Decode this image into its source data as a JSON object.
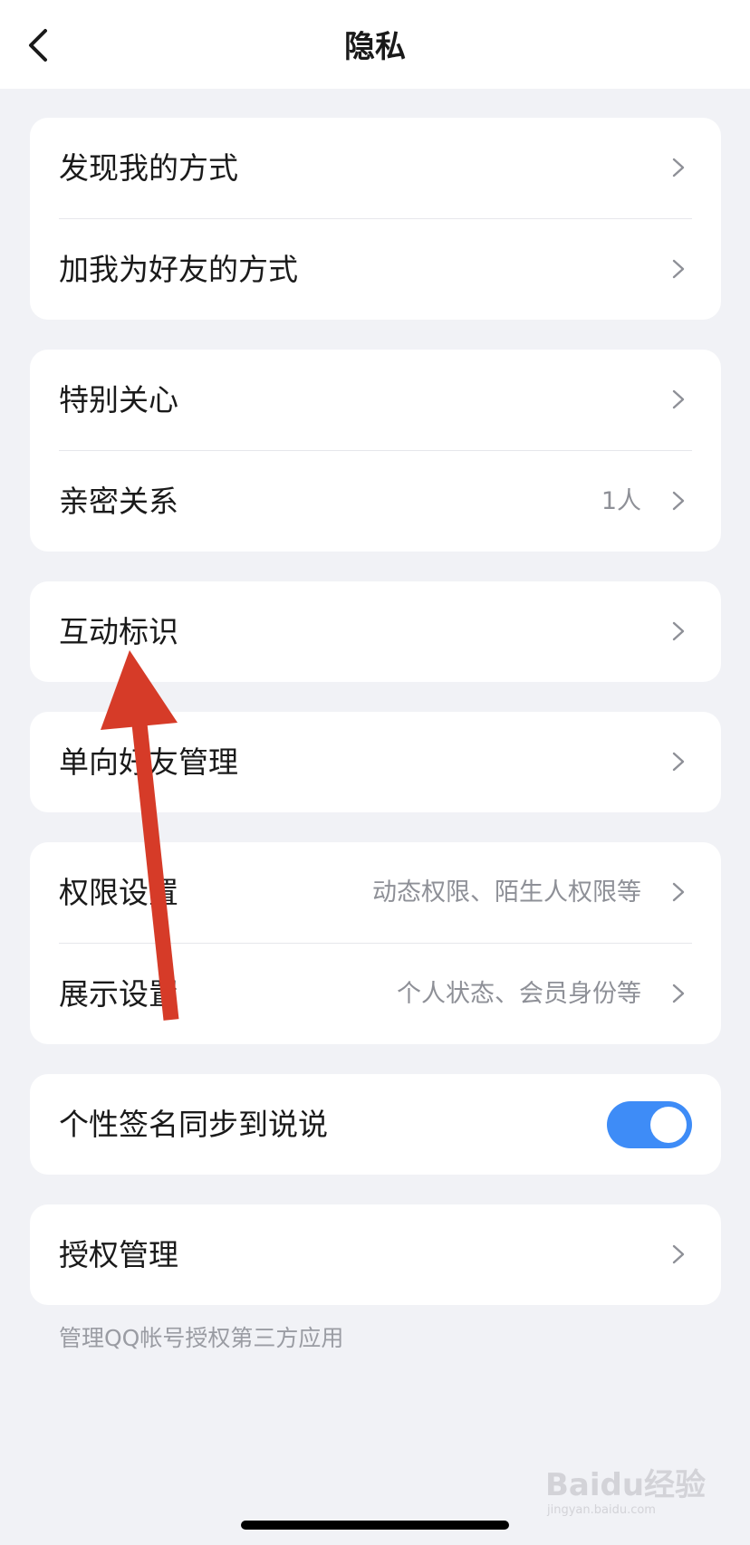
{
  "header": {
    "title": "隐私"
  },
  "groups": [
    {
      "rows": [
        {
          "label": "发现我的方式",
          "value": ""
        },
        {
          "label": "加我为好友的方式",
          "value": ""
        }
      ]
    },
    {
      "rows": [
        {
          "label": "特别关心",
          "value": ""
        },
        {
          "label": "亲密关系",
          "value": "1人"
        }
      ]
    },
    {
      "rows": [
        {
          "label": "互动标识",
          "value": ""
        }
      ]
    },
    {
      "rows": [
        {
          "label": "单向好友管理",
          "value": ""
        }
      ]
    },
    {
      "rows": [
        {
          "label": "权限设置",
          "value": "动态权限、陌生人权限等"
        },
        {
          "label": "展示设置",
          "value": "个人状态、会员身份等"
        }
      ]
    },
    {
      "rows": [
        {
          "label": "个性签名同步到说说",
          "toggle_on": true
        }
      ]
    },
    {
      "rows": [
        {
          "label": "授权管理",
          "value": ""
        }
      ]
    }
  ],
  "footnote": "管理QQ帐号授权第三方应用",
  "watermark": {
    "brand": "Baidu经验",
    "url": "jingyan.baidu.com"
  },
  "colors": {
    "background": "#F1F2F6",
    "accent_toggle": "#3E8CF7",
    "annotation_arrow": "#D63B28"
  }
}
